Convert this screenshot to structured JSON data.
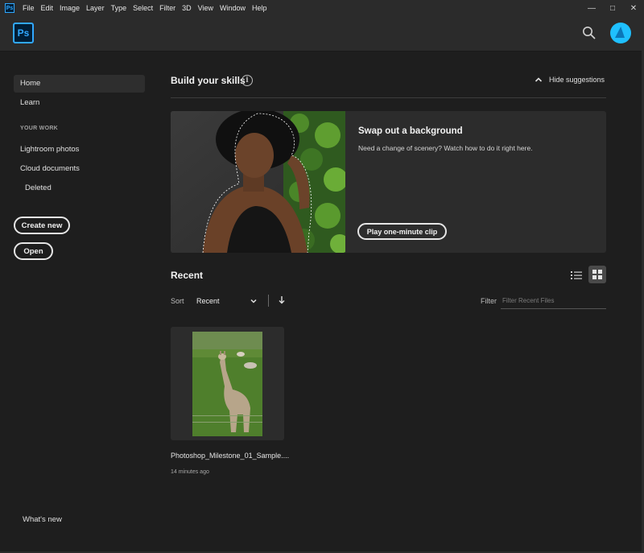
{
  "app": {
    "logo_text": "Ps",
    "brand_color": "#31a8ff"
  },
  "menubar": {
    "items": [
      "File",
      "Edit",
      "Image",
      "Layer",
      "Type",
      "Select",
      "Filter",
      "3D",
      "View",
      "Window",
      "Help"
    ],
    "window_controls": [
      "minimize",
      "maximize",
      "close"
    ]
  },
  "header": {
    "search_icon": "search-icon",
    "avatar_icon": "user-avatar"
  },
  "sidebar": {
    "home": "Home",
    "learn": "Learn",
    "section_label": "YOUR WORK",
    "lightroom": "Lightroom photos",
    "cloud_docs": "Cloud documents",
    "deleted": "Deleted",
    "create_new": "Create new",
    "open": "Open",
    "whats_new": "What's new"
  },
  "skills": {
    "title": "Build your skills",
    "info_icon": "info-icon",
    "hide_label": "Hide suggestions",
    "card": {
      "title": "Swap out a background",
      "description": "Need a change of scenery? Watch how to do it right here.",
      "button": "Play one-minute clip"
    }
  },
  "recent": {
    "title": "Recent",
    "sort_label": "Sort",
    "sort_value": "Recent",
    "filter_label": "Filter",
    "filter_placeholder": "Filter Recent Files",
    "view_mode": "grid",
    "files": [
      {
        "name": "Photoshop_Milestone_01_Sample....",
        "time": "14 minutes ago"
      }
    ]
  }
}
